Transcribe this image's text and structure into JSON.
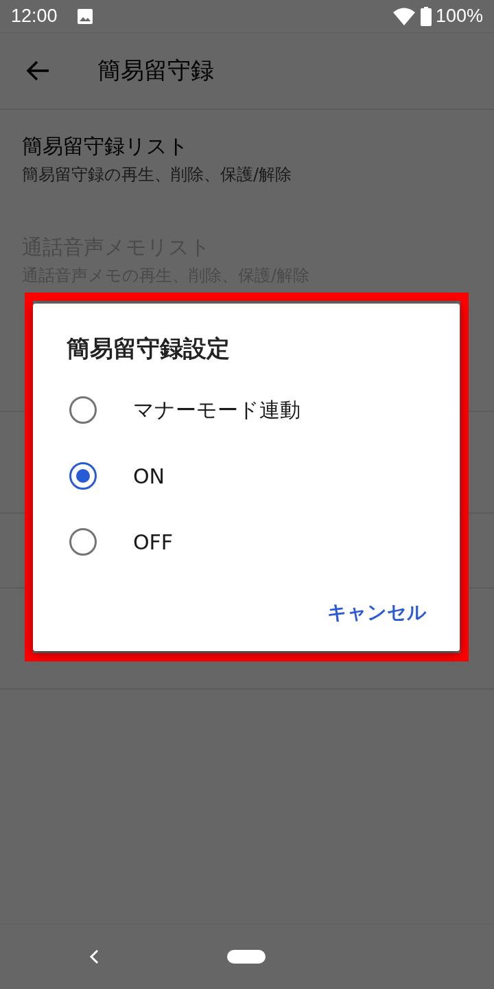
{
  "status_bar": {
    "time": "12:00",
    "battery": "100%"
  },
  "app_bar": {
    "title": "簡易留守録"
  },
  "preferences": [
    {
      "title": "簡易留守録リスト",
      "summary": "簡易留守録の再生、削除、保護/解除",
      "disabled": false
    },
    {
      "title": "通話音声メモリスト",
      "summary": "通話音声メモの再生、削除、保護/解除",
      "disabled": true
    }
  ],
  "dialog": {
    "title": "簡易留守録設定",
    "options": [
      {
        "label": "マナーモード連動",
        "selected": false
      },
      {
        "label": "ON",
        "selected": true
      },
      {
        "label": "OFF",
        "selected": false
      }
    ],
    "buttons": [
      "キャンセル"
    ]
  }
}
